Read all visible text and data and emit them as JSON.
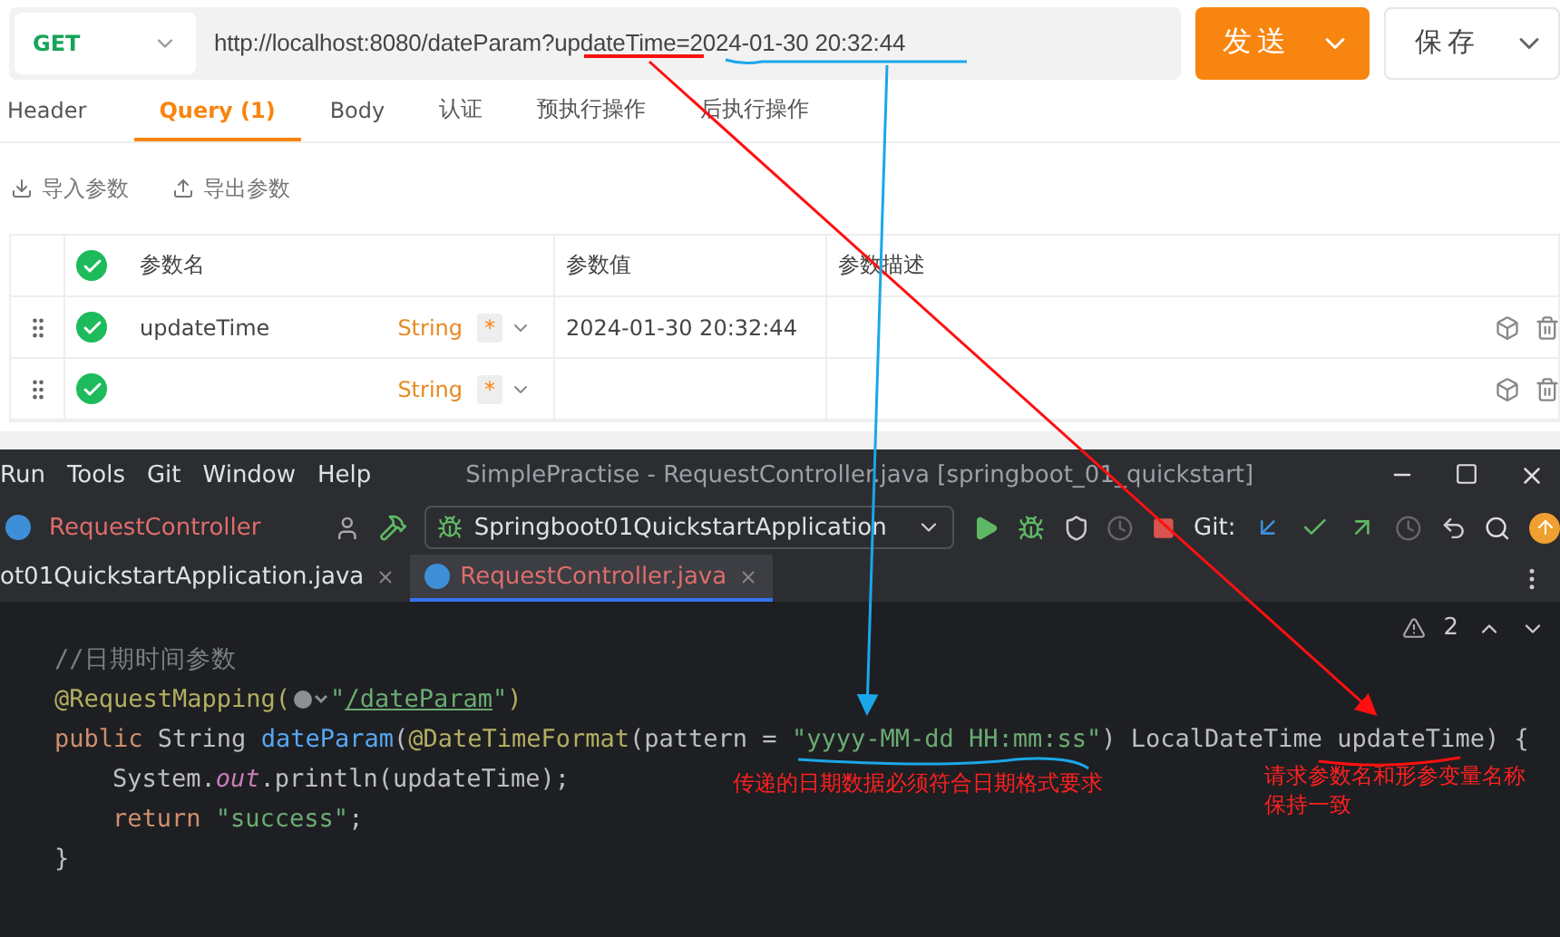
{
  "request": {
    "method": "GET",
    "url_base": "http://localhost:8080/dateParam?",
    "url_param": "updateTime",
    "url_eq": "=",
    "url_value": "2024-01-30 20:32:44",
    "send": "发送",
    "save": "保存"
  },
  "tabs": [
    {
      "label": "Header",
      "selected": false
    },
    {
      "label": "Query",
      "count": "(1)",
      "selected": true
    },
    {
      "label": "Body",
      "selected": false
    },
    {
      "label": "认证",
      "selected": false
    },
    {
      "label": "预执行操作",
      "selected": false
    },
    {
      "label": "后执行操作",
      "selected": false
    }
  ],
  "actions": [
    {
      "kind": "import",
      "label": "导入参数"
    },
    {
      "kind": "export",
      "label": "导出参数"
    }
  ],
  "params": {
    "columns": [
      "参数名",
      "参数值",
      "参数描述"
    ],
    "header_checked": true,
    "rows": [
      {
        "checked": true,
        "name": "updateTime",
        "type": "String",
        "required": "*",
        "value": "2024-01-30 20:32:44"
      },
      {
        "checked": true,
        "type": "String",
        "required": "*"
      }
    ]
  },
  "ide": {
    "menu": [
      "Run",
      "Tools",
      "Git",
      "Window",
      "Help"
    ],
    "title": "SimplePractise - RequestController.java [springboot_01_quickstart]",
    "class_crumb": "RequestController",
    "run_config": "Springboot01QuickstartApplication",
    "git_label": "Git:",
    "tabs": [
      {
        "label": "ot01QuickstartApplication.java",
        "selected": false
      },
      {
        "label": "RequestController.java",
        "selected": true
      }
    ],
    "warnings": "2",
    "code": [
      [
        {
          "kind": "comment",
          "text": "//日期时间参数"
        }
      ],
      [
        {
          "kind": "annotation",
          "text": "@RequestMapping("
        },
        {
          "kind": "globe"
        },
        {
          "kind": "string",
          "text": "\""
        },
        {
          "kind": "link",
          "text": "/dateParam"
        },
        {
          "kind": "string",
          "text": "\""
        },
        {
          "kind": "annotation",
          "text": ")"
        }
      ],
      [
        {
          "kind": "keyword",
          "text": "public "
        },
        {
          "kind": "plain",
          "text": "String "
        },
        {
          "kind": "func",
          "text": "dateParam"
        },
        {
          "kind": "plain",
          "text": "("
        },
        {
          "kind": "annotation",
          "text": "@DateTimeFormat"
        },
        {
          "kind": "plain",
          "text": "(pattern = "
        },
        {
          "kind": "string",
          "text": "\"yyyy-MM-dd HH:mm:ss\""
        },
        {
          "kind": "plain",
          "text": ") LocalDateTime updateTime) {"
        }
      ],
      [
        {
          "kind": "indent"
        },
        {
          "kind": "plain",
          "text": "System."
        },
        {
          "kind": "field",
          "text": "out"
        },
        {
          "kind": "plain",
          "text": ".println(updateTime);"
        }
      ],
      [
        {
          "kind": "indent"
        },
        {
          "kind": "keyword",
          "text": "return "
        },
        {
          "kind": "string",
          "text": "\"success\""
        },
        {
          "kind": "plain",
          "text": ";"
        }
      ],
      [
        {
          "kind": "plain",
          "text": "}"
        }
      ]
    ]
  },
  "notes": [
    {
      "lines": [
        "传递的日期数据必须符合日期格式要求"
      ]
    },
    {
      "lines": [
        "请求参数名和形参变量名称",
        "保持一致"
      ]
    }
  ]
}
